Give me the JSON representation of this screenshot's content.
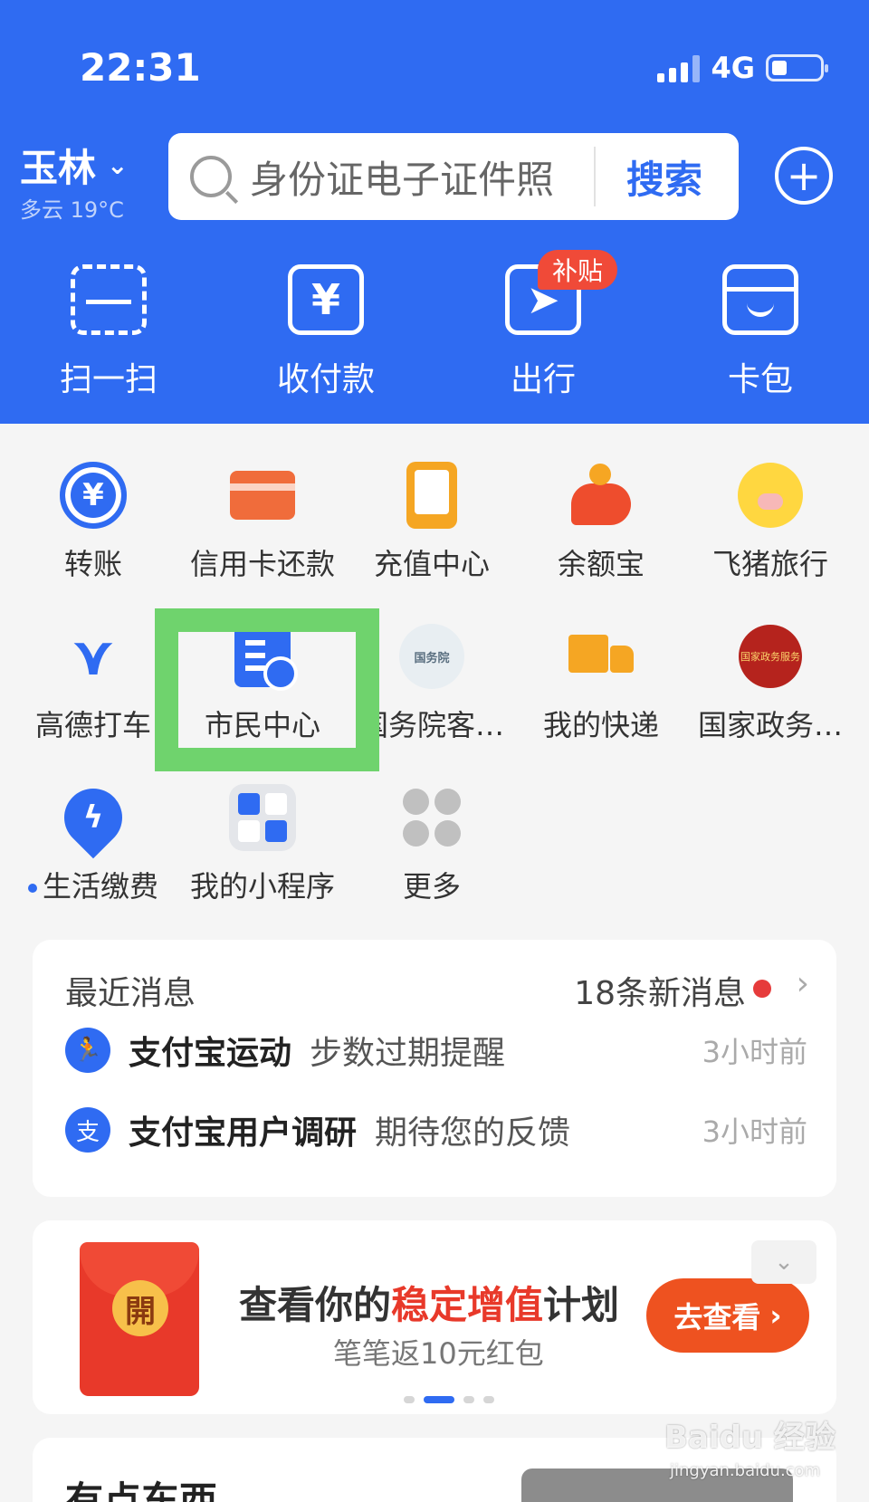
{
  "status_bar": {
    "time": "22:31",
    "network": "4G"
  },
  "header": {
    "city": "玉林",
    "weather": "多云 19°C",
    "search_placeholder": "身份证电子证件照",
    "search_button": "搜索",
    "actions": [
      {
        "label": "扫一扫",
        "icon": "scan-icon"
      },
      {
        "label": "收付款",
        "icon": "payment-icon"
      },
      {
        "label": "出行",
        "icon": "travel-icon",
        "badge": "补贴"
      },
      {
        "label": "卡包",
        "icon": "card-wallet-icon"
      }
    ]
  },
  "grid": {
    "row1": [
      {
        "label": "转账",
        "icon": "transfer-icon"
      },
      {
        "label": "信用卡还款",
        "icon": "credit-card-icon"
      },
      {
        "label": "充值中心",
        "icon": "recharge-icon"
      },
      {
        "label": "余额宝",
        "icon": "yuebao-icon"
      },
      {
        "label": "飞猪旅行",
        "icon": "fliggy-icon"
      }
    ],
    "row2": [
      {
        "label": "高德打车",
        "icon": "gaode-icon"
      },
      {
        "label": "市民中心",
        "icon": "citizen-center-icon"
      },
      {
        "label": "国务院客…",
        "icon": "state-council-icon",
        "icon_text": "国务院"
      },
      {
        "label": "我的快递",
        "icon": "express-icon"
      },
      {
        "label": "国家政务…",
        "icon": "gov-service-icon",
        "icon_text": "国家政务服务"
      }
    ],
    "row3": [
      {
        "label": "生活缴费",
        "icon": "utility-icon"
      },
      {
        "label": "我的小程序",
        "icon": "mini-program-icon"
      },
      {
        "label": "更多",
        "icon": "more-icon"
      }
    ]
  },
  "messages": {
    "title": "最近消息",
    "count": "18条新消息",
    "items": [
      {
        "source": "支付宝运动",
        "text": "步数过期提醒",
        "time": "3小时前",
        "icon": "sport-icon"
      },
      {
        "source": "支付宝用户调研",
        "text": "期待您的反馈",
        "time": "3小时前",
        "icon": "alipay-icon"
      }
    ]
  },
  "promo": {
    "coin_text": "開",
    "title_pre": "查看你的",
    "title_highlight": "稳定增值",
    "title_post": "计划",
    "subtitle": "笔笔返10元红包",
    "button": "去查看",
    "page_count": 4,
    "active_page": 1
  },
  "feed": {
    "title": "有点东西"
  },
  "watermark": {
    "brand": "Baidu 经验",
    "url": "jingyan.baidu.com"
  },
  "colors": {
    "brand_blue": "#2f6bf2",
    "highlight_green": "#6fd36d",
    "promo_red": "#e8392a"
  }
}
